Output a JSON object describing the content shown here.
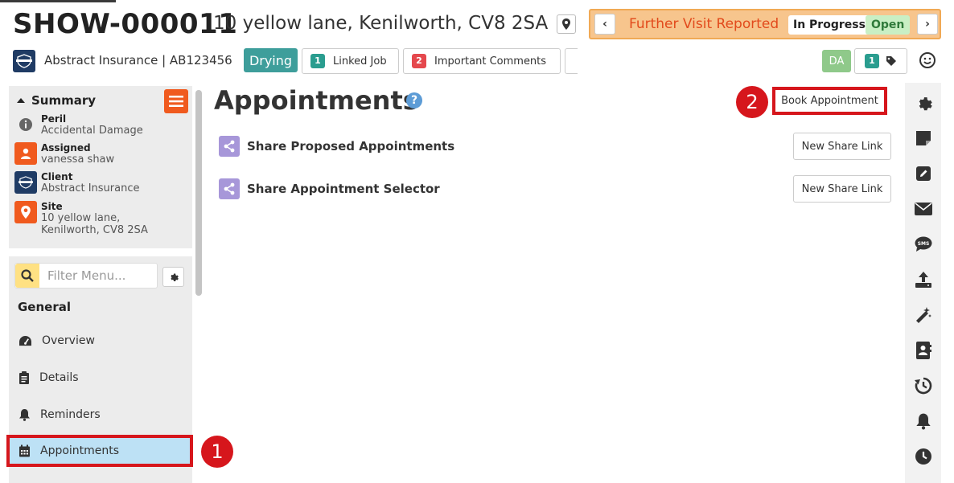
{
  "header": {
    "job_id": "SHOW-000011",
    "address": "10 yellow lane, Kenilworth, CV8 2SA",
    "status": {
      "text": "Further Visit Reported",
      "progress": "In Progress",
      "state": "Open"
    },
    "client_line": "Abstract Insurance | AB123456",
    "client_logo_text": "INSURANCE",
    "drying_label": "Drying",
    "linked_job": {
      "count": "1",
      "label": "Linked Job"
    },
    "important_comments": {
      "count": "2",
      "label": "Important Comments"
    },
    "user_initials": "DA",
    "tag_count": "1"
  },
  "summary": {
    "title": "Summary",
    "items": [
      {
        "label": "Peril",
        "value": "Accidental Damage",
        "icon": "info-icon"
      },
      {
        "label": "Assigned",
        "value": "vanessa shaw",
        "icon": "user-icon"
      },
      {
        "label": "Client",
        "value": "Abstract Insurance",
        "icon": "insurance-logo"
      },
      {
        "label": "Site",
        "value": "10 yellow lane, Kenilworth, CV8 2SA",
        "icon": "map-pin-icon"
      }
    ]
  },
  "menu": {
    "filter_placeholder": "Filter Menu...",
    "section": "General",
    "items": [
      {
        "label": "Overview",
        "icon": "dashboard-icon"
      },
      {
        "label": "Details",
        "icon": "clipboard-icon"
      },
      {
        "label": "Reminders",
        "icon": "bell-icon"
      },
      {
        "label": "Appointments",
        "icon": "calendar-icon",
        "active": true
      }
    ]
  },
  "main": {
    "title": "Appointments",
    "book_button": "Book Appointment",
    "share_rows": [
      {
        "label": "Share Proposed Appointments",
        "button": "New Share Link"
      },
      {
        "label": "Share Appointment Selector",
        "button": "New Share Link"
      }
    ]
  },
  "callouts": [
    "1",
    "2"
  ],
  "rail_icons": [
    "gear-icon",
    "note-icon",
    "edit-icon",
    "mail-icon",
    "sms-icon",
    "upload-icon",
    "magic-wand-icon",
    "contact-book-icon",
    "history-icon",
    "bell-icon",
    "clock-icon"
  ],
  "colors": {
    "status_bg": "#f7c58d",
    "status_text": "#e24a1c",
    "drying": "#3e9e9b",
    "active_menu": "#bde1f5",
    "callout_red": "#d6161c",
    "hamburger": "#f05a1e",
    "share_icon": "#a797d9"
  }
}
